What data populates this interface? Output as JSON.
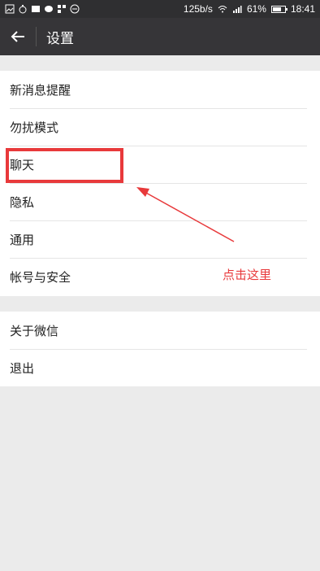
{
  "status_bar": {
    "network_speed": "125b/s",
    "battery_text": "61%",
    "battery_level": 0.61,
    "time": "18:41"
  },
  "app_bar": {
    "title": "设置"
  },
  "settings": {
    "group1": [
      {
        "label": "新消息提醒"
      },
      {
        "label": "勿扰模式"
      },
      {
        "label": "聊天"
      },
      {
        "label": "隐私"
      },
      {
        "label": "通用"
      },
      {
        "label": "帐号与安全"
      }
    ],
    "group2": [
      {
        "label": "关于微信"
      },
      {
        "label": "退出"
      }
    ]
  },
  "annotation": {
    "text": "点击这里",
    "color": "#e8393b"
  }
}
